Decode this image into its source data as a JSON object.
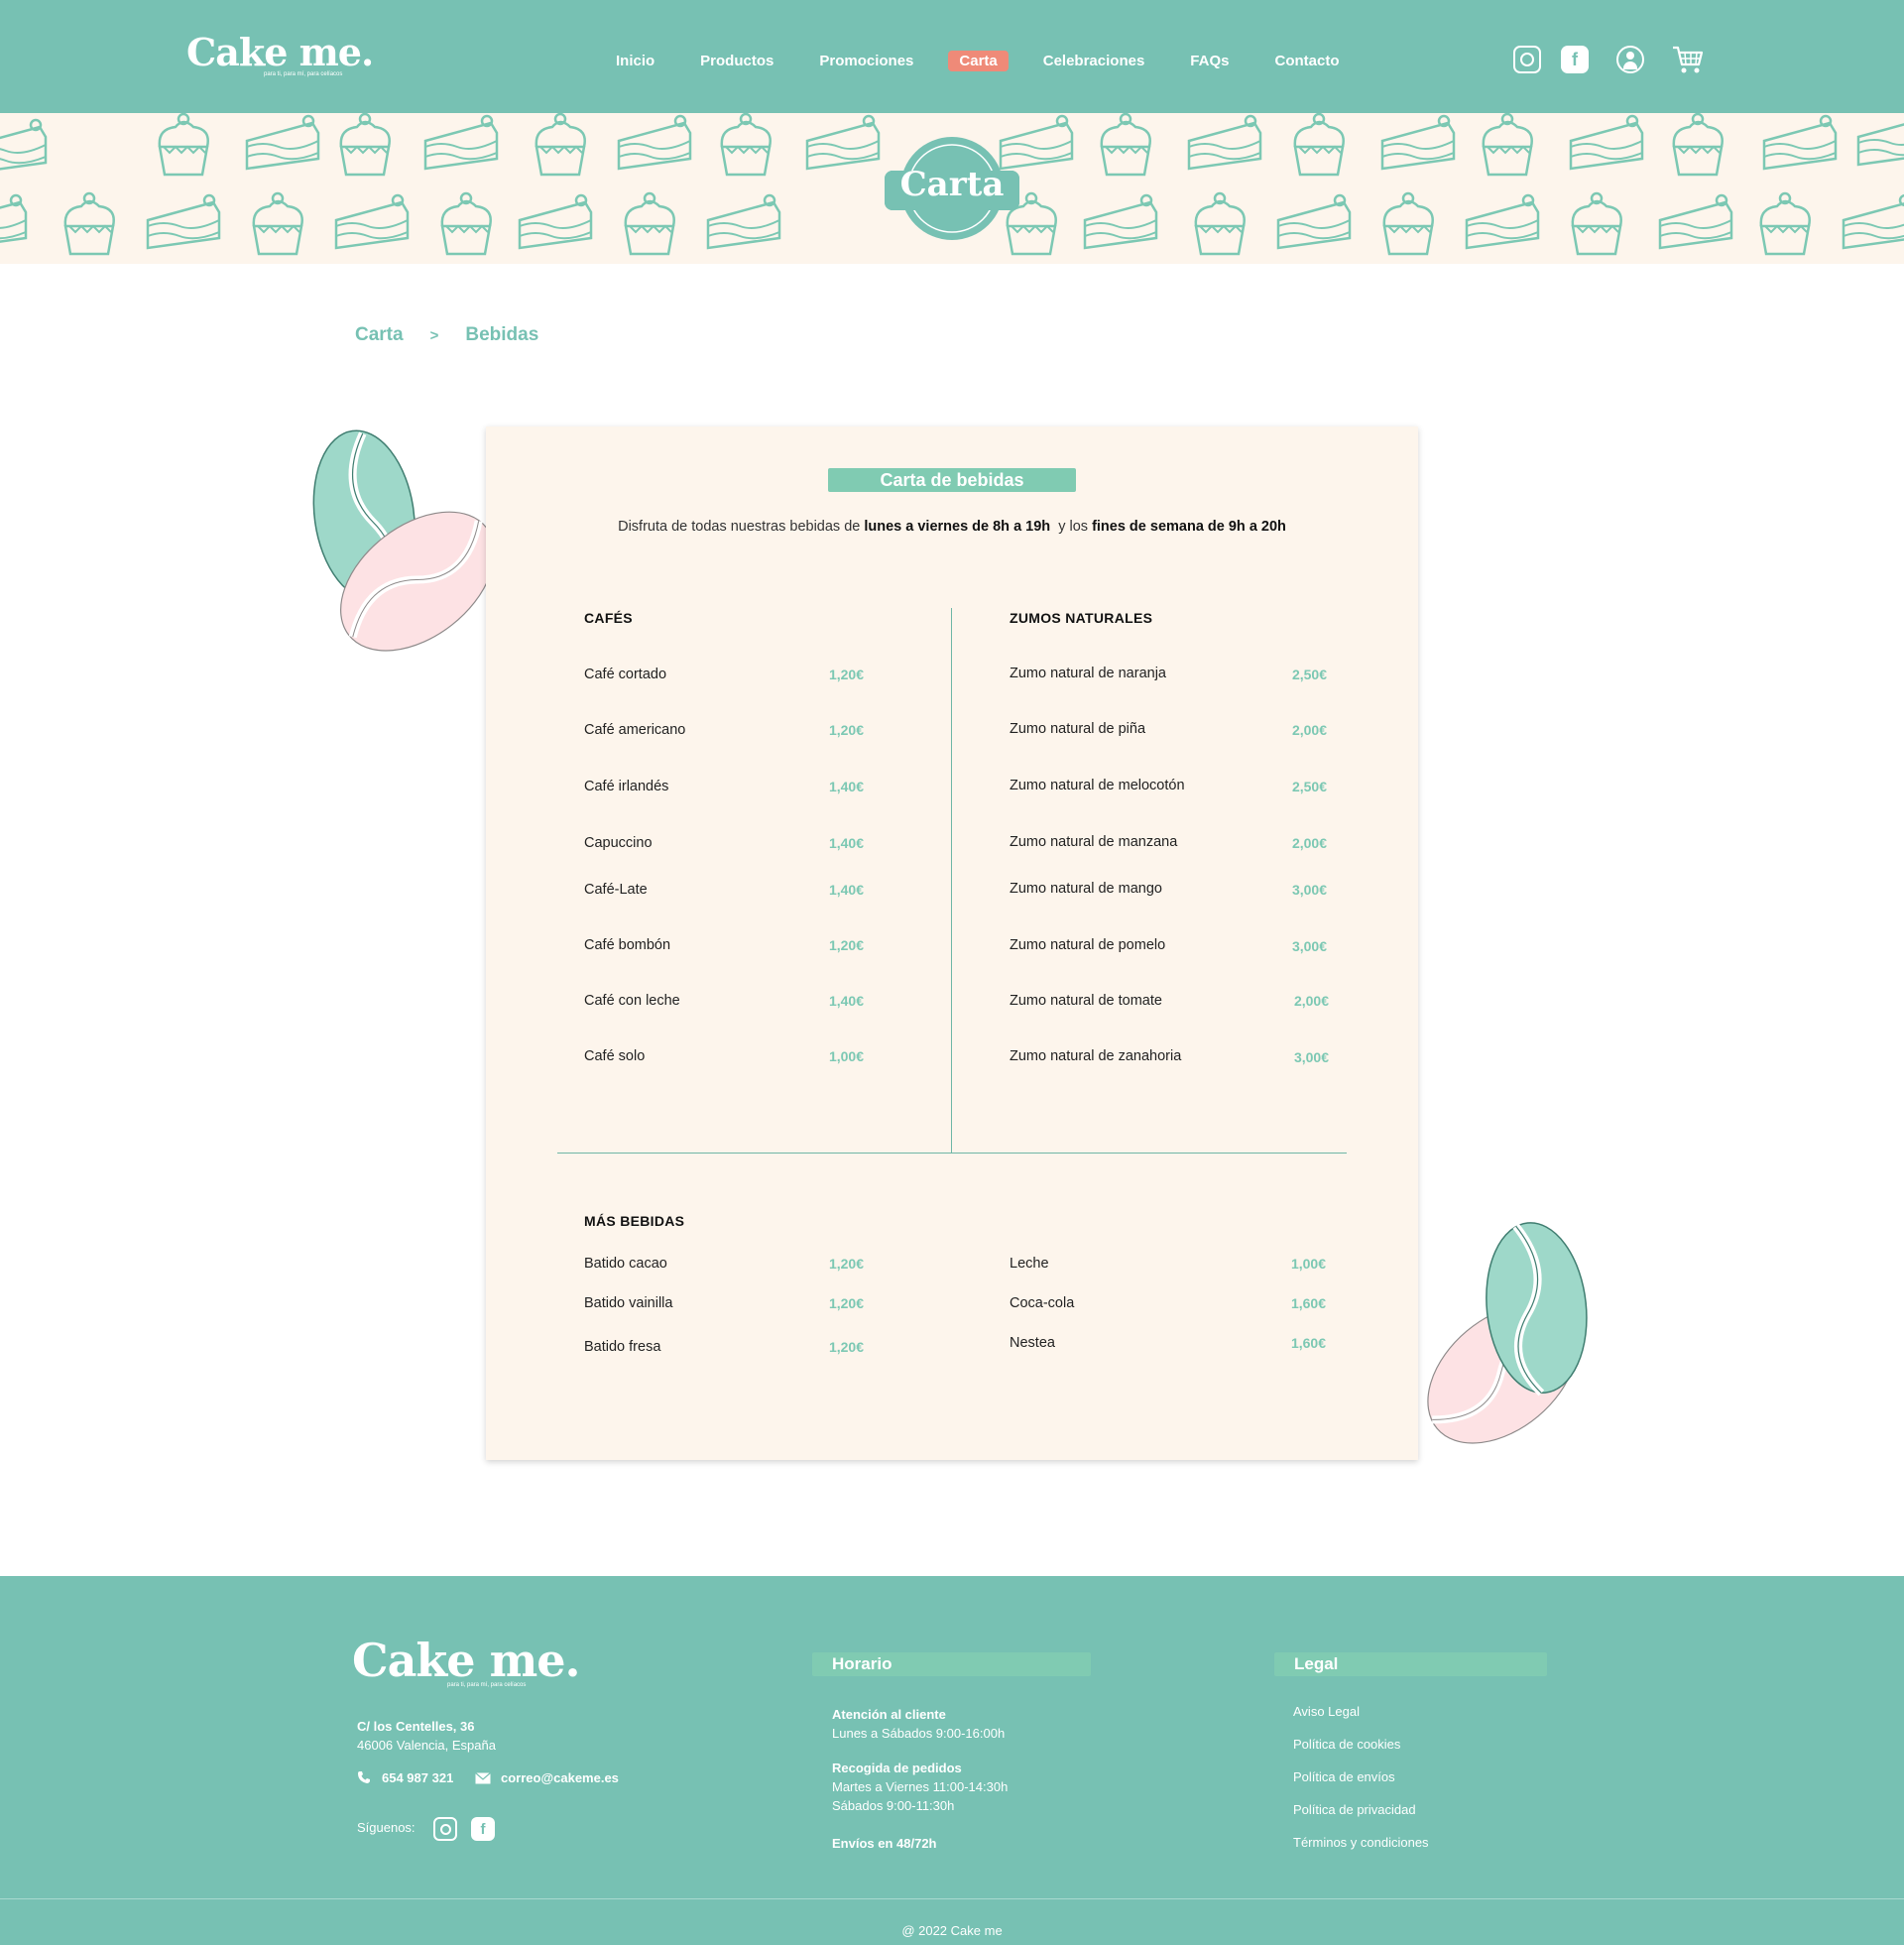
{
  "colors": {
    "primary": "#77c1b3",
    "accent": "#ef8a78",
    "cream": "#fdf5ec",
    "price": "#7cc8b3"
  },
  "header": {
    "logo": "Cake me.",
    "tagline": "para ti, para mí, para celíacos",
    "nav": [
      "Inicio",
      "Productos",
      "Promociones",
      "Carta",
      "Celebraciones",
      "FAQs",
      "Contacto"
    ],
    "active": "Carta",
    "icons": [
      "instagram-icon",
      "facebook-icon",
      "user-icon",
      "cart-icon"
    ]
  },
  "banner": {
    "title": "Carta"
  },
  "breadcrumb": {
    "parent": "Carta",
    "separator": ">",
    "current": "Bebidas"
  },
  "menu": {
    "title": "Carta de bebidas",
    "subtitle_pre": "Disfruta de todas nuestras bebidas de ",
    "subtitle_b1": "lunes a viernes de 8h a 19h",
    "subtitle_mid": "  y los ",
    "subtitle_b2": "fines de semana de 9h a 20h",
    "cafes": {
      "title": "CAFÉS",
      "items": [
        {
          "name": "Café cortado",
          "price": "1,20€"
        },
        {
          "name": "Café americano",
          "price": "1,20€"
        },
        {
          "name": "Café irlandés",
          "price": "1,40€"
        },
        {
          "name": "Capuccino",
          "price": "1,40€"
        },
        {
          "name": "Café-Late",
          "price": "1,40€"
        },
        {
          "name": "Café bombón",
          "price": "1,20€"
        },
        {
          "name": "Café con leche",
          "price": "1,40€"
        },
        {
          "name": "Café solo",
          "price": "1,00€"
        }
      ]
    },
    "zumos": {
      "title": "ZUMOS NATURALES",
      "items": [
        {
          "name": "Zumo natural de naranja",
          "price": "2,50€"
        },
        {
          "name": "Zumo natural de piña",
          "price": "2,00€"
        },
        {
          "name": "Zumo natural de melocotón",
          "price": "2,50€"
        },
        {
          "name": "Zumo natural de manzana",
          "price": "2,00€"
        },
        {
          "name": "Zumo natural de mango",
          "price": "3,00€"
        },
        {
          "name": "Zumo natural de pomelo",
          "price": "3,00€"
        },
        {
          "name": "Zumo natural de tomate",
          "price": "2,00€"
        },
        {
          "name": "Zumo natural de zanahoria",
          "price": "3,00€"
        }
      ]
    },
    "mas": {
      "title": "MÁS BEBIDAS",
      "left": [
        {
          "name": "Batido cacao",
          "price": "1,20€"
        },
        {
          "name": "Batido vainilla",
          "price": "1,20€"
        },
        {
          "name": "Batido fresa",
          "price": "1,20€"
        }
      ],
      "right": [
        {
          "name": "Leche",
          "price": "1,00€"
        },
        {
          "name": "Coca-cola",
          "price": "1,60€"
        },
        {
          "name": "Nestea",
          "price": "1,60€"
        }
      ]
    }
  },
  "footer": {
    "logo": "Cake me.",
    "tagline": "para ti, para mí, para celíacos",
    "address1": "C/ los Centelles, 36",
    "address2": "46006 Valencia, España",
    "phone": "654 987 321",
    "email": "correo@cakeme.es",
    "follow": "Síguenos:",
    "horario": {
      "title": "Horario",
      "l1_title": "Atención al cliente",
      "l1": "Lunes a Sábados 9:00-16:00h",
      "l2_title": "Recogida de pedidos",
      "l2a": "Martes a Viernes 11:00-14:30h",
      "l2b": "Sábados 9:00-11:30h",
      "l3_title": "Envíos en 48/72h"
    },
    "legal": {
      "title": "Legal",
      "links": [
        "Aviso Legal",
        "Política de cookies",
        "Política de envíos",
        "Política de privacidad",
        "Términos y condiciones"
      ]
    },
    "copyright": "@ 2022 Cake me"
  }
}
